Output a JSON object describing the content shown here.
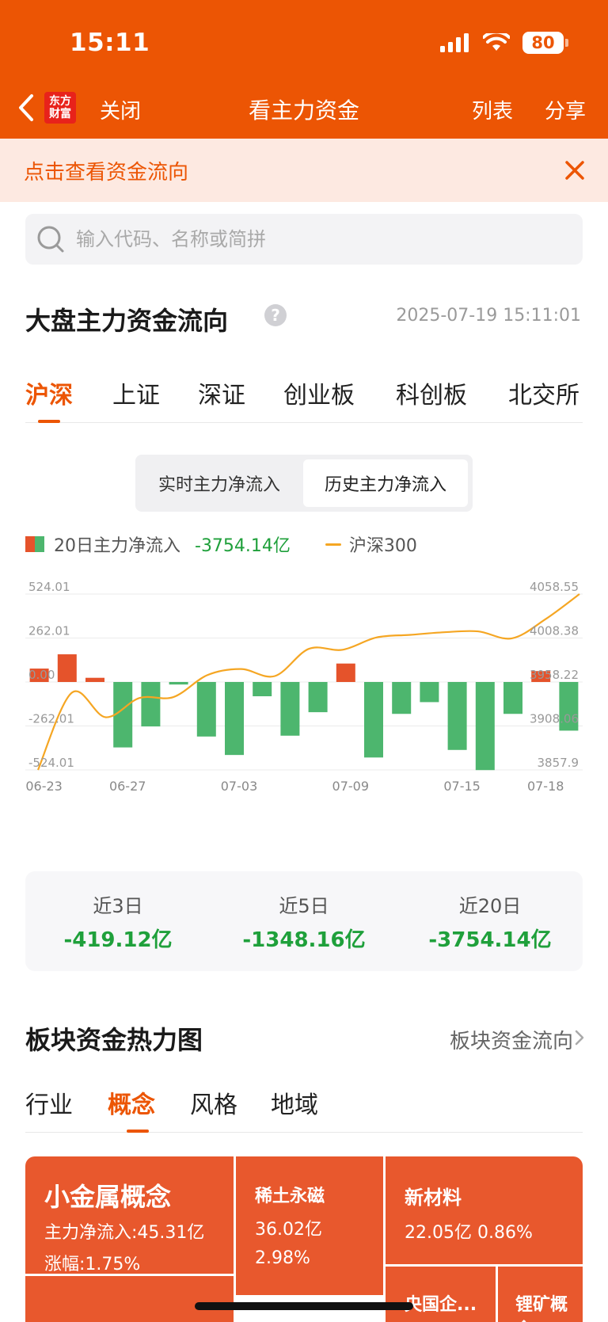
{
  "status_bar": {
    "time": "15:11",
    "battery": "80"
  },
  "nav": {
    "logo_line1": "东方",
    "logo_line2": "财富",
    "close": "关闭",
    "title": "看主力资金",
    "list": "列表",
    "share": "分享"
  },
  "banner": {
    "text": "点击查看资金流向"
  },
  "search": {
    "placeholder": "输入代码、名称或简拼"
  },
  "section1": {
    "title": "大盘主力资金流向",
    "help": "?",
    "timestamp": "2025-07-19 15:11:01"
  },
  "market_tabs": [
    "沪深",
    "上证",
    "深证",
    "创业板",
    "科创板",
    "北交所"
  ],
  "toggle": {
    "realtime": "实时主力净流入",
    "history": "历史主力净流入"
  },
  "legend": {
    "flow_label": "20日主力净流入",
    "flow_value": "-3754.14亿",
    "index_label": "沪深300"
  },
  "colors": {
    "brand": "#EC5504",
    "inflow": "#E5532B",
    "outflow": "#4DB66E",
    "index_line": "#F5A623",
    "stat_green": "#1FA03B"
  },
  "chart_data": {
    "type": "bar",
    "title": "",
    "y_left_ticks": [
      "524.01",
      "262.01",
      "0.00",
      "-262.01",
      "-524.01"
    ],
    "y_right_ticks": [
      "4058.55",
      "4008.38",
      "3958.22",
      "3908.06",
      "3857.9"
    ],
    "ylim_left": [
      -524.01,
      524.01
    ],
    "ylim_right": [
      3857.9,
      4058.55
    ],
    "x_labels": [
      "06-23",
      "06-27",
      "07-03",
      "07-09",
      "07-15",
      "07-18"
    ],
    "x_label_positions": [
      0,
      3,
      7,
      11,
      15,
      18
    ],
    "series": [
      {
        "name": "20日主力净流入",
        "values": [
          80,
          165,
          25,
          -390,
          -265,
          -15,
          -325,
          -435,
          -85,
          -320,
          -180,
          110,
          -450,
          -190,
          -120,
          -405,
          -525,
          -190,
          65,
          -290
        ]
      },
      {
        "name": "沪深300",
        "values": [
          3857.9,
          3946,
          3918,
          3940,
          3941,
          3966,
          3973,
          3965,
          3996,
          3995,
          4009,
          4012,
          4015,
          4016,
          4008,
          4030,
          4058.55
        ]
      }
    ]
  },
  "stats": [
    {
      "label": "近3日",
      "value": "-419.12亿"
    },
    {
      "label": "近5日",
      "value": "-1348.16亿"
    },
    {
      "label": "近20日",
      "value": "-3754.14亿"
    }
  ],
  "section2": {
    "title": "板块资金热力图",
    "link": "板块资金流向"
  },
  "sector_tabs": [
    "行业",
    "概念",
    "风格",
    "地域"
  ],
  "heatmap": {
    "c1": {
      "name": "小金属概念",
      "line1": "主力净流入:45.31亿",
      "line2": "涨幅:1.75%"
    },
    "c2": {
      "name": "稀土永磁",
      "flow": "36.02亿",
      "change": "2.98%"
    },
    "c3": {
      "name": "新材料",
      "flow_change": "22.05亿  0.86%"
    },
    "c4": {
      "name": "央国企..."
    },
    "c5": {
      "name": "锂矿概念"
    }
  }
}
